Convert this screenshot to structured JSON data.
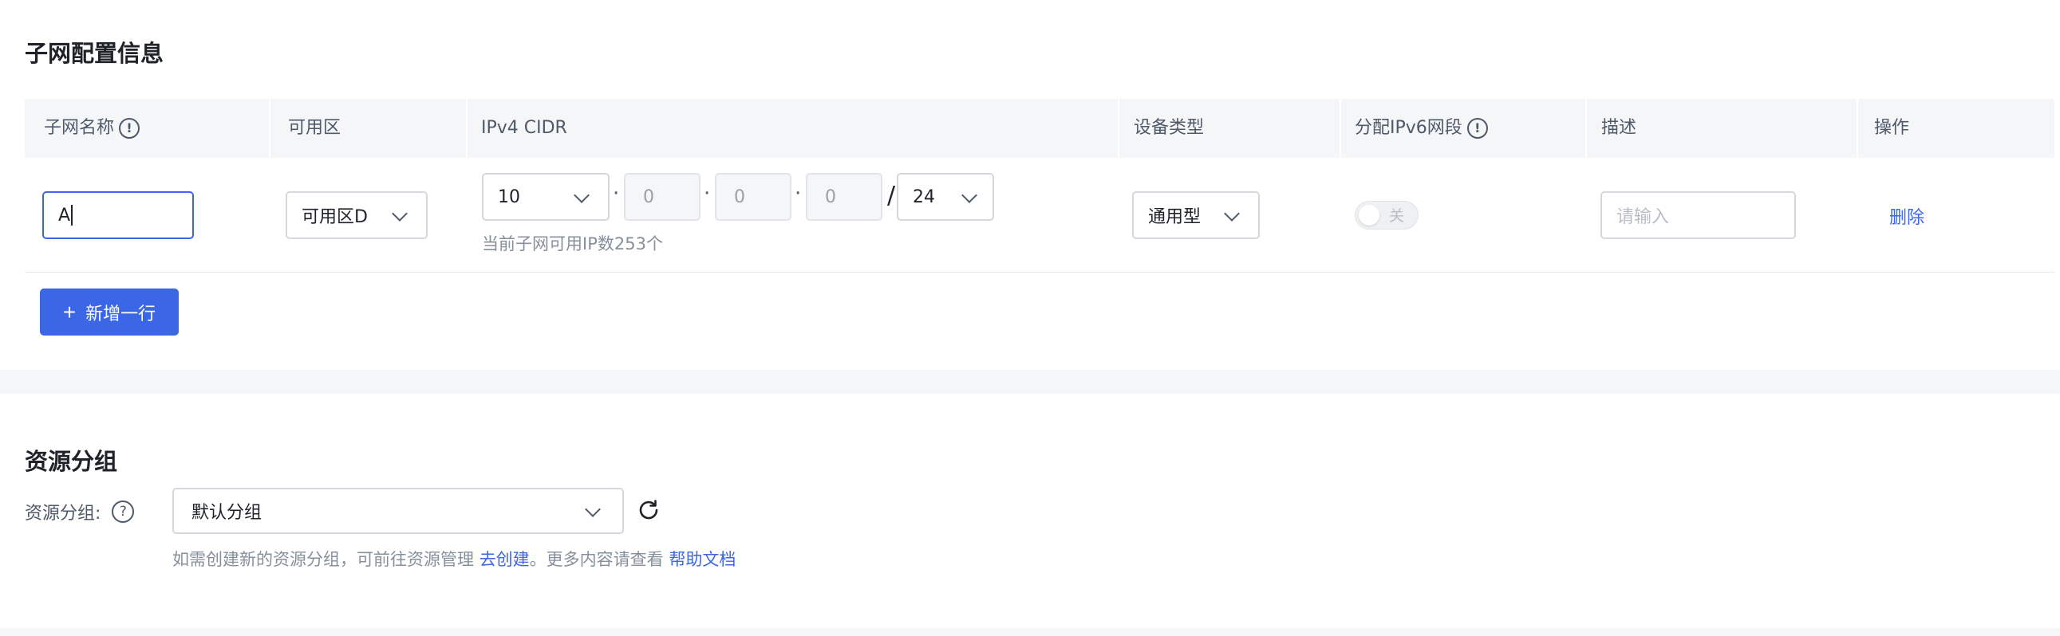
{
  "subnet_section": {
    "title": "子网配置信息",
    "columns": {
      "name": "子网名称",
      "zone": "可用区",
      "cidr": "IPv4 CIDR",
      "device_type": "设备类型",
      "ipv6": "分配IPv6网段",
      "description": "描述",
      "action": "操作"
    },
    "info_glyph": "!",
    "row": {
      "name_value": "A",
      "zone_value": "可用区D",
      "cidr_octet1": "10",
      "cidr_octet2": "0",
      "cidr_octet3": "0",
      "cidr_octet4": "0",
      "cidr_mask": "24",
      "dot": "·",
      "slash": "/",
      "available_ip_hint": "当前子网可用IP数253个",
      "device_type_value": "通用型",
      "ipv6_toggle_label": "关",
      "ipv6_enabled": false,
      "description_placeholder": "请输入",
      "delete_label": "删除"
    },
    "add_row_label": "新增一行",
    "add_row_icon": "+"
  },
  "resource_section": {
    "title": "资源分组",
    "label": "资源分组:",
    "help_glyph": "?",
    "select_value": "默认分组",
    "help_prefix": "如需创建新的资源分组，可前往资源管理 ",
    "create_link": "去创建",
    "help_middle": "。更多内容请查看 ",
    "docs_link": "帮助文档"
  },
  "colors": {
    "primary": "#3b66e6",
    "header_bg": "#f5f6f8",
    "muted_text": "#86909c"
  },
  "icons": [
    "info-icon",
    "chevron-down-icon",
    "plus-icon",
    "question-icon",
    "refresh-icon"
  ]
}
